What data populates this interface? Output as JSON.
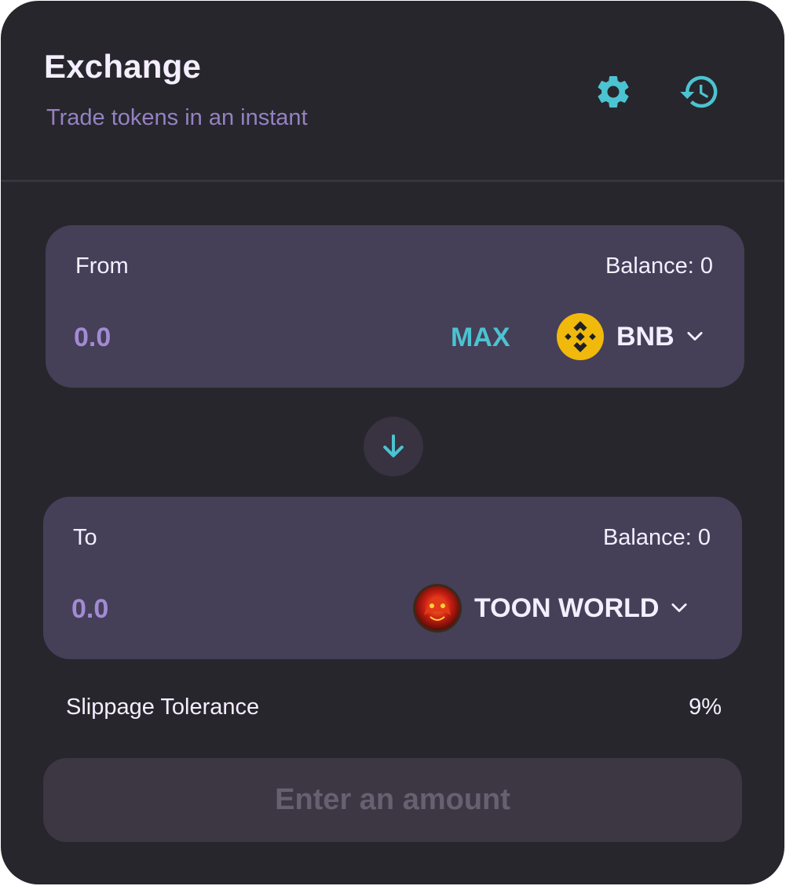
{
  "header": {
    "title": "Exchange",
    "subtitle": "Trade tokens in an instant",
    "settings_icon": "gear-icon",
    "history_icon": "history-icon"
  },
  "from": {
    "label": "From",
    "balance": "Balance: 0",
    "amount_placeholder": "0.0",
    "max_label": "MAX",
    "token": {
      "symbol": "BNB",
      "icon": "bnb-logo-icon"
    }
  },
  "switch": {
    "icon": "arrow-down-icon"
  },
  "to": {
    "label": "To",
    "balance": "Balance: 0",
    "amount_placeholder": "0.0",
    "token": {
      "symbol": "TOON WORLD",
      "icon": "toon-world-logo-icon"
    }
  },
  "slippage": {
    "label": "Slippage Tolerance",
    "value": "9%"
  },
  "submit": {
    "label": "Enter an amount"
  },
  "colors": {
    "card_bg": "#27262c",
    "panel_bg": "#453f58",
    "accent": "#4cc3d0",
    "primary_text": "#f4eeff",
    "secondary_text": "#a28bd4",
    "disabled_text": "#666171"
  }
}
